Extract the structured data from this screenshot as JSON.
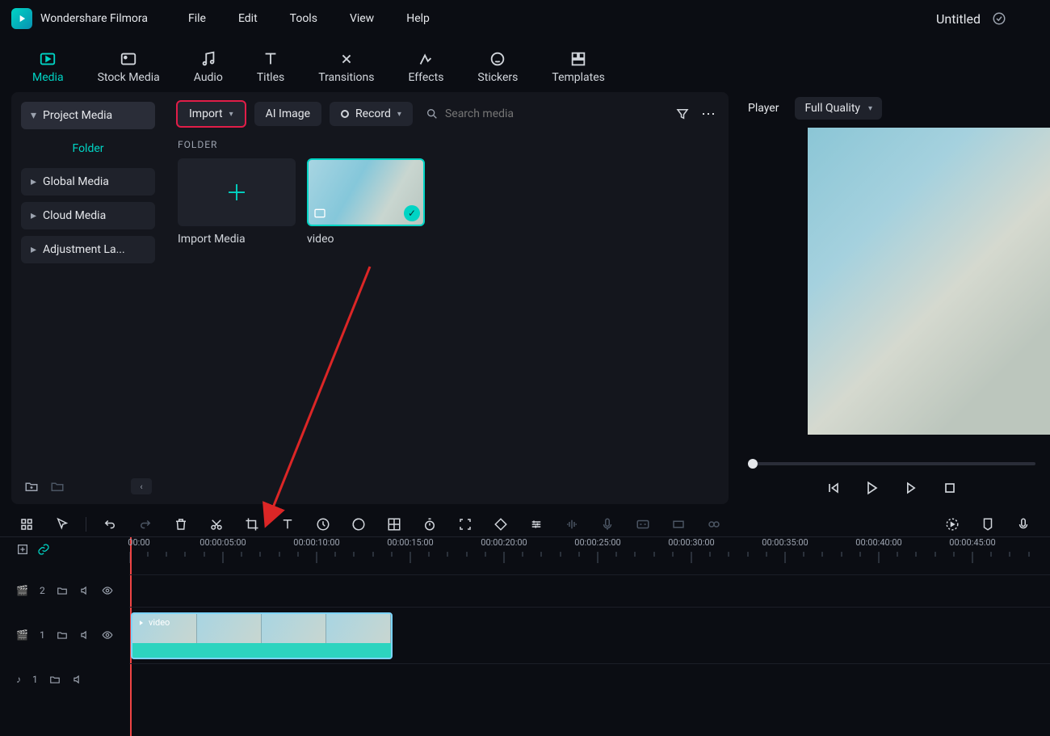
{
  "titlebar": {
    "app_name": "Wondershare Filmora",
    "project_title": "Untitled"
  },
  "menu": {
    "file": "File",
    "edit": "Edit",
    "tools": "Tools",
    "view": "View",
    "help": "Help"
  },
  "tabs": {
    "media": "Media",
    "stock": "Stock Media",
    "audio": "Audio",
    "titles": "Titles",
    "transitions": "Transitions",
    "effects": "Effects",
    "stickers": "Stickers",
    "templates": "Templates"
  },
  "sidebar": {
    "project": "Project Media",
    "folder": "Folder",
    "global": "Global Media",
    "cloud": "Cloud Media",
    "adjust": "Adjustment La..."
  },
  "toolbar": {
    "import": "Import",
    "ai_image": "AI Image",
    "record": "Record",
    "search_ph": "Search media"
  },
  "folder_header": "FOLDER",
  "thumbs": {
    "import": "Import Media",
    "video": "video"
  },
  "player": {
    "name": "Player",
    "quality": "Full Quality"
  },
  "ruler": {
    "t0": "00:00",
    "t5": "00:00:05:00",
    "t10": "00:00:10:00",
    "t15": "00:00:15:00",
    "t20": "00:00:20:00",
    "t25": "00:00:25:00",
    "t30": "00:00:30:00",
    "t35": "00:00:35:00",
    "t40": "00:00:40:00",
    "t45": "00:00:45:00"
  },
  "tracks": {
    "v2": "2",
    "v1": "1",
    "a1": "1"
  },
  "clip_label": "video"
}
